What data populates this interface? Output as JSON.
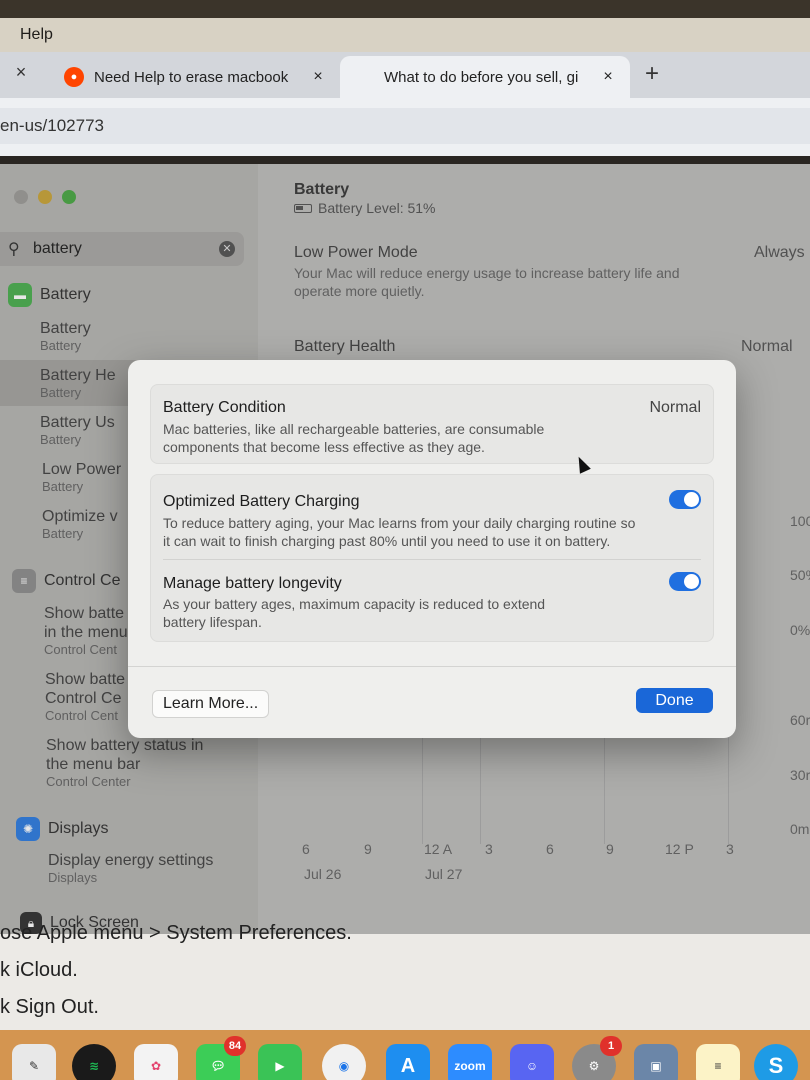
{
  "menubar": {
    "help": "Help"
  },
  "browser": {
    "tabs": [
      {
        "title": "Need Help to erase macbook",
        "icon": "reddit-icon"
      },
      {
        "title": "What to do before you sell, gi",
        "icon": "apple-icon"
      }
    ],
    "close_glyph": "×",
    "new_tab_glyph": "+",
    "url": "en-us/102773"
  },
  "settings": {
    "search_query": "battery",
    "sidebar": {
      "battery_category": "Battery",
      "items": [
        {
          "title": "Battery",
          "sub": "Battery"
        },
        {
          "title": "Battery He",
          "sub": "Battery"
        },
        {
          "title": "Battery Us",
          "sub": "Battery"
        },
        {
          "title": "Low Power",
          "sub": "Battery"
        },
        {
          "title": "Optimize v",
          "sub": "Battery"
        }
      ],
      "control_center_category": "Control Ce",
      "cc_items": [
        {
          "title": "Show batte",
          "title2": "in the menu",
          "sub": "Control Cent"
        },
        {
          "title": "Show batte",
          "title2": "Control Ce",
          "sub": "Control Cent"
        },
        {
          "title": "Show battery status in",
          "title2": "the menu bar",
          "sub": "Control Center"
        }
      ],
      "displays_category": "Displays",
      "displays_item": {
        "title": "Display energy settings",
        "sub": "Displays"
      },
      "lock_screen": "Lock Screen"
    },
    "main": {
      "title": "Battery",
      "battery_level": "Battery Level: 51%",
      "low_power_mode": "Low Power Mode",
      "low_power_value": "Always",
      "low_power_desc_1": "Your Mac will reduce energy usage to increase battery life and",
      "low_power_desc_2": "operate more quietly.",
      "battery_health": "Battery Health",
      "battery_health_value": "Normal",
      "chart_y_labels": [
        "100",
        "50%",
        "0%",
        "60r",
        "30r",
        "0m"
      ],
      "chart_x_labels": [
        "6",
        "9",
        "12 A",
        "3",
        "6",
        "9",
        "12 P",
        "3"
      ],
      "chart_dates": [
        "Jul 26",
        "Jul 27"
      ]
    }
  },
  "modal": {
    "condition_title": "Battery Condition",
    "condition_value": "Normal",
    "condition_desc_1": "Mac batteries, like all rechargeable batteries, are consumable",
    "condition_desc_2": "components that become less effective as they age.",
    "optimized_title": "Optimized Battery Charging",
    "optimized_desc_1": "To reduce battery aging, your Mac learns from your daily charging routine so",
    "optimized_desc_2": "it can wait to finish charging past 80% until you need to use it on battery.",
    "optimized_on": true,
    "longevity_title": "Manage battery longevity",
    "longevity_desc_1": "As your battery ages, maximum capacity is reduced to extend",
    "longevity_desc_2": "battery lifespan.",
    "longevity_on": true,
    "learn_more": "Learn More...",
    "done": "Done"
  },
  "article": {
    "line1": "ose Apple menu  > System Preferences.",
    "line2": "k iCloud.",
    "line3": "k Sign Out."
  },
  "dock": {
    "messages_badge": "84",
    "settings_badge": "1",
    "zoom_label": "zoom",
    "skype_label": "S"
  }
}
